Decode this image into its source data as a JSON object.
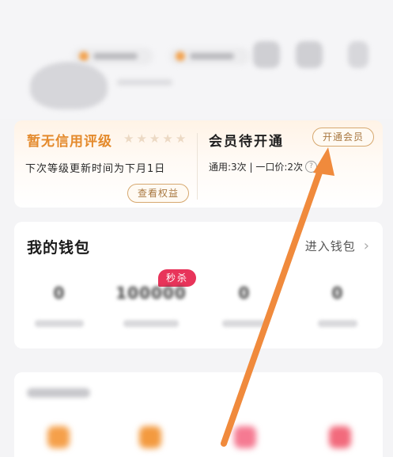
{
  "credit": {
    "title": "暂无信用评级",
    "stars": [
      "★",
      "★",
      "★",
      "★",
      "★"
    ],
    "update_text": "下次等级更新时间为下月1日",
    "view_button": "查看权益"
  },
  "member": {
    "title": "会员待开通",
    "open_button": "开通会员",
    "sub_text": "通用:3次 | 一口价:2次",
    "help_icon_glyph": "?"
  },
  "wallet": {
    "title": "我的钱包",
    "enter_link": "进入钱包",
    "chevron": "›",
    "seckill_badge": "秒杀",
    "items": [
      {
        "value": "0"
      },
      {
        "value": "100000"
      },
      {
        "value": "0"
      },
      {
        "value": "0"
      }
    ]
  },
  "colors": {
    "accent_orange": "#e48a2c",
    "badge_red": "#e8345a",
    "annotation_arrow": "#f08a3c"
  },
  "icons": {
    "annotation": "arrow-pointer"
  }
}
